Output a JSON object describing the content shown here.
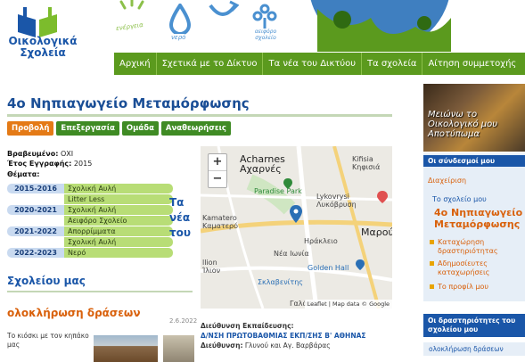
{
  "header": {
    "logo_line1": "Οικολογικά",
    "logo_line2": "Σχολεία",
    "banner_icons": [
      "energy-icon",
      "water-icon",
      "recycling-icon",
      "wind-icon",
      "globe-icon"
    ],
    "banner_labels": [
      "ενέργεια",
      "νερό",
      "αειφόρο σχολείο"
    ]
  },
  "nav": {
    "items": [
      "Αρχική",
      "Σχετικά με το Δίκτυο",
      "Τα νέα του Δικτύου",
      "Τα σχολεία",
      "Αίτηση συμμετοχής"
    ]
  },
  "page": {
    "title": "4ο Νηπιαγωγείο Μεταμόρφωσης",
    "tabs": [
      "Προβολή",
      "Επεξεργασία",
      "Ομάδα",
      "Αναθεωρήσεις"
    ],
    "awarded_label": "Βραβευμένο:",
    "awarded_value": "ΟΧΙ",
    "year_label": "Έτος Εγγραφής:",
    "year_value": "2015",
    "themes_label": "Θέματα:",
    "themes": [
      {
        "year": "2015-2016",
        "theme": "Σχολική Αυλή"
      },
      {
        "year": "",
        "theme": "Litter Less"
      },
      {
        "year": "2020-2021",
        "theme": "Σχολική Αυλή"
      },
      {
        "year": "",
        "theme": "Αειφόρο Σχολείο"
      },
      {
        "year": "2021-2022",
        "theme": "Απορρίμματα"
      },
      {
        "year": "",
        "theme": "Σχολική Αυλή"
      },
      {
        "year": "2022-2023",
        "theme": "Νερό"
      }
    ],
    "school_words": [
      "Τα",
      "νέα",
      "του"
    ],
    "school_tail": "Σχολείου μας",
    "section_title": "ολοκλήρωση δράσεων",
    "section_date": "2.6.2022",
    "news_text": "Το κιόσκι με τον κηπάκο μας"
  },
  "map": {
    "labels": [
      "Acharnes",
      "Αχαρνές",
      "Kifisia",
      "Κηφισιά",
      "Paradise Park",
      "Lykovrysi",
      "Λυκόβρυση",
      "Kamatero",
      "Καματερό",
      "Ηράκλειο",
      "Μαρού",
      "Νέα Ιωνία",
      "Golden Hall",
      "llion",
      "Ίλιον",
      "Σκλαβενίτης",
      "Γαλάτσι"
    ],
    "zoom_in": "+",
    "zoom_out": "−",
    "attribution": "Leaflet | Map data © Google"
  },
  "address": {
    "admin_label": "Διεύθυνση Εκπαίδευσης:",
    "admin_value": "Δ/ΝΣΗ ΠΡΩΤΟΒΑΘΜΙΑΣ ΕΚΠ/ΣΗΣ Β' ΑΘΗΝΑΣ",
    "street_label": "Διεύθυνση:",
    "street_value": "Γλυνού και Αγ. Βαρβάρας"
  },
  "sidebar": {
    "promo_line1": "Μειώνω το",
    "promo_line2": "Οικολογικό μου",
    "promo_line3": "Αποτύπωμα",
    "links_heading": "Οι σύνδεσμοί μου",
    "admin": "Διαχείριση",
    "my_school": "Το σχολείο μου",
    "school_name": "4ο Νηπιαγωγείο Μεταμόρφωσης",
    "links": [
      "Καταχώρηση δραστηριότητας",
      "Αδημοσίευτες καταχωρήσεις",
      "Το προφίλ μου"
    ],
    "activities_heading": "Οι δραστηριότητες του σχολείου μου",
    "activity_item": "ολοκλήρωση δράσεων"
  },
  "colors": {
    "nav_green": "#5b9a1e",
    "title_blue": "#1a56a8",
    "accent_orange": "#e47a16",
    "tab_green": "#3f8b24"
  }
}
